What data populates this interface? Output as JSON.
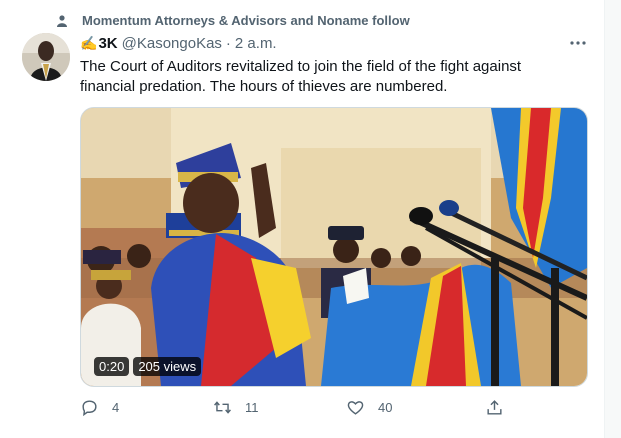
{
  "social_context": "Momentum Attorneys & Advisors and Noname follow",
  "tweet": {
    "name_emoji": "✍️",
    "name": "3K",
    "handle": "@KasongoKas",
    "separator": "·",
    "time": "2 a.m.",
    "text": "The Court of Auditors revitalized to join the field of the fight against financial predation. The hours of thieves are numbered."
  },
  "media": {
    "duration": "0:20",
    "views": "205 views"
  },
  "actions": {
    "reply_count": "4",
    "retweet_count": "11",
    "like_count": "40"
  },
  "colors": {
    "text": "#0f1419",
    "secondary": "#536471",
    "flag_blue": "#1f7fd1",
    "flag_red": "#d8262a",
    "flag_yellow": "#f7d21e"
  },
  "icons": [
    "person-icon",
    "more-icon",
    "reply-icon",
    "retweet-icon",
    "like-icon",
    "share-icon"
  ]
}
